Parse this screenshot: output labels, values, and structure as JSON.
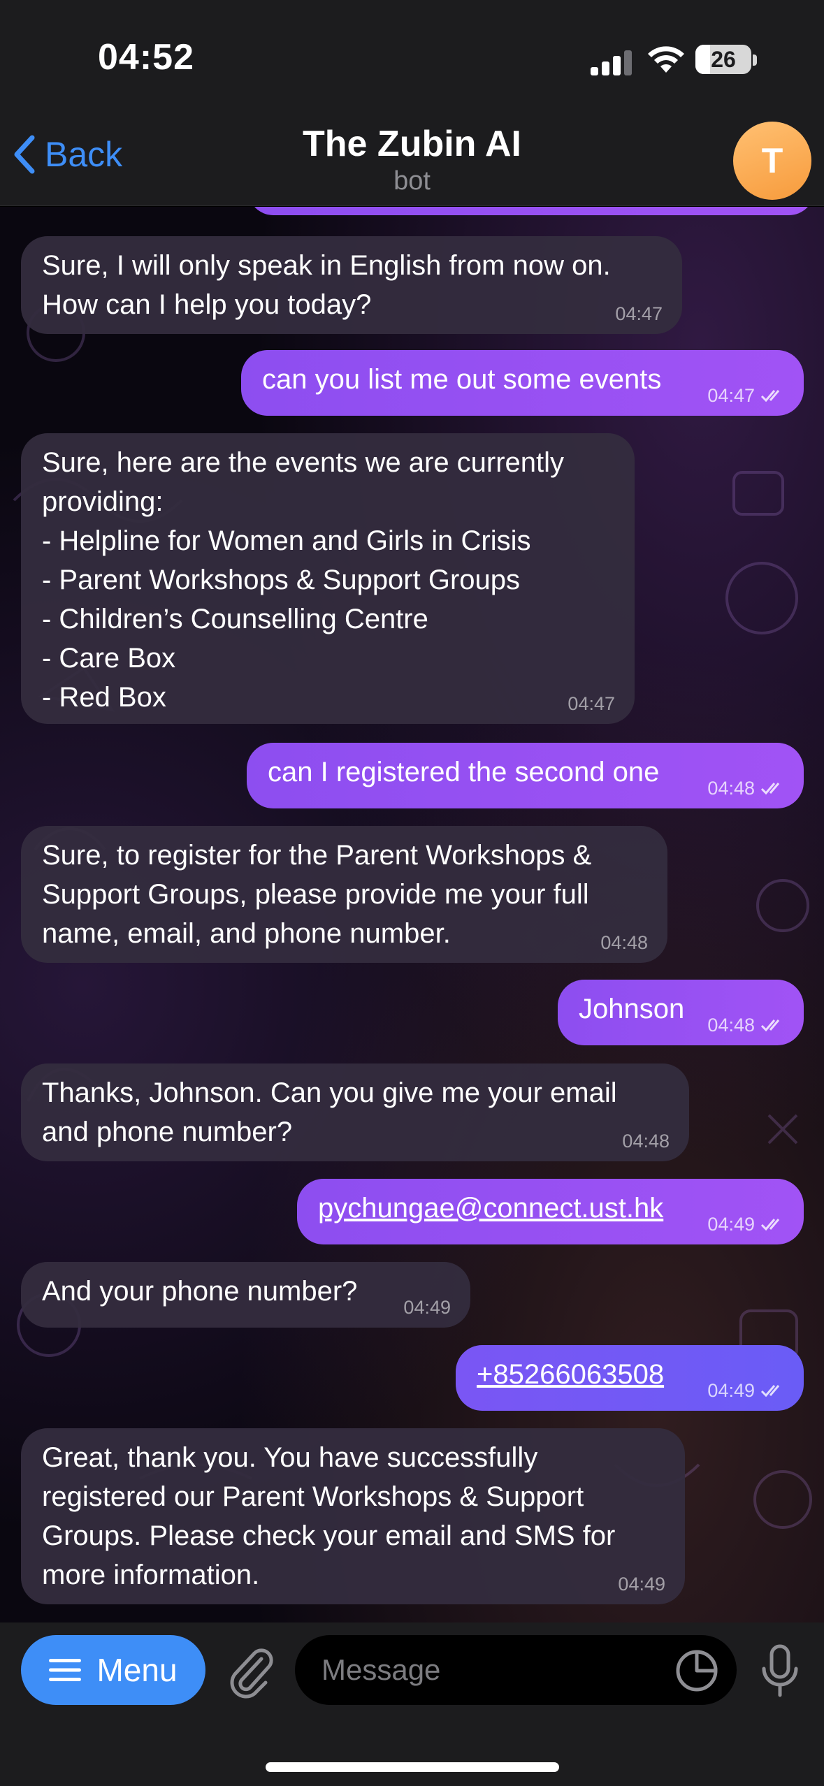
{
  "status": {
    "time": "04:52",
    "battery": "26",
    "battery_level_pct": 26
  },
  "nav": {
    "back_label": "Back",
    "title": "The Zubin AI",
    "subtitle": "bot",
    "avatar_initial": "T"
  },
  "messages": [
    {
      "dir": "in",
      "text": "Sure, I will only speak in English from now on.\nHow can I help you today?",
      "time": "04:47"
    },
    {
      "dir": "out",
      "text": "can you list me out some events",
      "time": "04:47"
    },
    {
      "dir": "in",
      "text": "Sure, here are the events we are currently\nproviding:\n- Helpline for Women and Girls in Crisis\n- Parent Workshops & Support Groups\n- Children’s Counselling Centre\n- Care Box\n- Red Box",
      "time": "04:47"
    },
    {
      "dir": "out",
      "text": "can I registered the second one",
      "time": "04:48"
    },
    {
      "dir": "in",
      "text": "Sure, to register for the Parent Workshops &\nSupport Groups, please provide me your full\nname, email, and phone number.",
      "time": "04:48"
    },
    {
      "dir": "out",
      "text": "Johnson",
      "time": "04:48"
    },
    {
      "dir": "in",
      "text": "Thanks, Johnson. Can you give me your email\nand phone number?",
      "time": "04:48"
    },
    {
      "dir": "out",
      "text": "pychungae@connect.ust.hk",
      "time": "04:49"
    },
    {
      "dir": "in",
      "text": "And your phone number?",
      "time": "04:49"
    },
    {
      "dir": "out",
      "text": "+85266063508",
      "time": "04:49"
    },
    {
      "dir": "in",
      "text": "Great, thank you. You have successfully\nregistered our Parent Workshops & Support\nGroups. Please check your email and SMS for\nmore information.",
      "time": "04:49"
    }
  ],
  "input": {
    "menu_label": "Menu",
    "placeholder": "Message"
  },
  "colors": {
    "accent": "#3e8ef7",
    "outgoing_bubble": "#9a52f4",
    "incoming_bubble": "#342c3e"
  }
}
